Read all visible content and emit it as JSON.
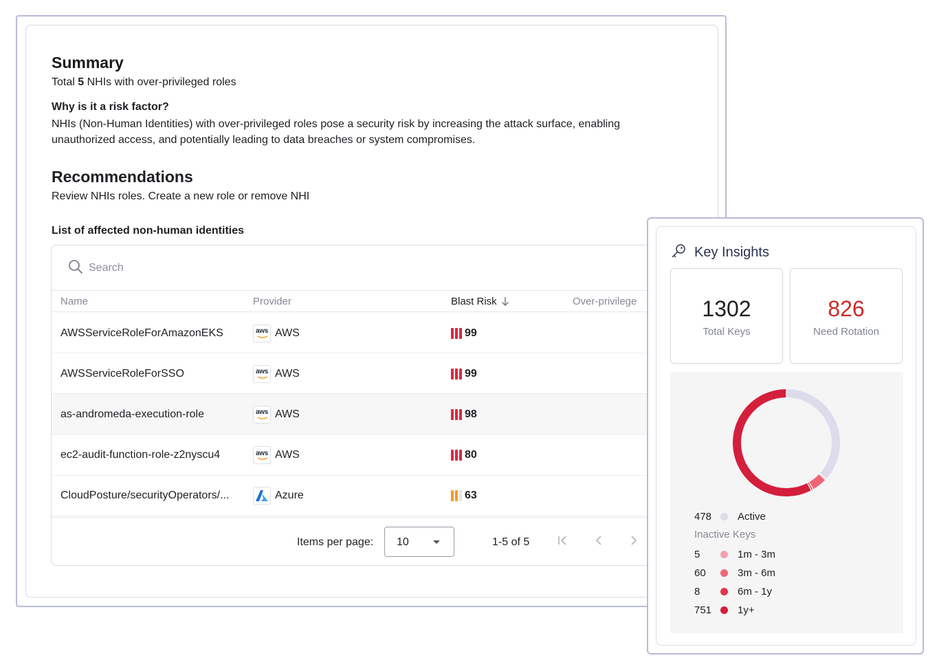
{
  "summary": {
    "heading": "Summary",
    "total_prefix": "Total",
    "total_count": "5",
    "total_suffix": "NHIs with over-privileged roles",
    "risk_question": "Why is it a risk factor?",
    "risk_text": "NHIs (Non-Human Identities) with over-privileged roles pose a security risk by increasing the attack surface, enabling unauthorized access, and potentially leading to data breaches or system compromises."
  },
  "recommendations": {
    "heading": "Recommendations",
    "text": "Review NHIs roles. Create a new role or remove NHI"
  },
  "list": {
    "title": "List of affected non-human identities",
    "search_placeholder": "Search",
    "columns": {
      "name": "Name",
      "provider": "Provider",
      "blast_risk": "Blast Risk",
      "over_privileged": "Over-privilege"
    },
    "rows": [
      {
        "name": "AWSServiceRoleForAmazonEKS",
        "provider": "AWS",
        "logo": "aws-logo",
        "risk": "99",
        "risk_bars_filled": 3,
        "risk_color": "#d62a44"
      },
      {
        "name": "AWSServiceRoleForSSO",
        "provider": "AWS",
        "logo": "aws-logo",
        "risk": "99",
        "risk_bars_filled": 3,
        "risk_color": "#d62a44"
      },
      {
        "name": "as-andromeda-execution-role",
        "provider": "AWS",
        "logo": "aws-logo",
        "risk": "98",
        "risk_bars_filled": 3,
        "risk_color": "#d62a44"
      },
      {
        "name": "ec2-audit-function-role-z2nyscu4",
        "provider": "AWS",
        "logo": "aws-logo",
        "risk": "80",
        "risk_bars_filled": 3,
        "risk_color": "#d62a44"
      },
      {
        "name": "CloudPosture/securityOperators/...",
        "provider": "Azure",
        "logo": "azure-logo",
        "risk": "63",
        "risk_bars_filled": 2,
        "risk_color": "#f29a27"
      }
    ],
    "pagination": {
      "items_per_page_label": "Items per page:",
      "items_per_page_value": "10",
      "range": "1-5 of 5"
    }
  },
  "key_insights": {
    "title": "Key Insights",
    "total_keys_value": "1302",
    "total_keys_label": "Total Keys",
    "need_rotation_value": "826",
    "need_rotation_label": "Need Rotation",
    "chart_data": {
      "type": "pie",
      "style": "donut",
      "categories": [
        "Active",
        "1m - 3m",
        "3m - 6m",
        "6m - 1y",
        "1y+"
      ],
      "values": [
        478,
        5,
        60,
        8,
        751
      ],
      "colors": [
        "#dcdcea",
        "#f5a0ae",
        "#ef6577",
        "#e3344d",
        "#d41f3c"
      ]
    },
    "legend": {
      "active": {
        "value": "478",
        "label": "Active",
        "color": "#dcdcea"
      },
      "inactive_label": "Inactive Keys",
      "inactive": [
        {
          "value": "5",
          "label": "1m - 3m",
          "color": "#f5a0ae"
        },
        {
          "value": "60",
          "label": "3m - 6m",
          "color": "#ef6577"
        },
        {
          "value": "8",
          "label": "6m - 1y",
          "color": "#e3344d"
        },
        {
          "value": "751",
          "label": "1y+",
          "color": "#d41f3c"
        }
      ]
    }
  }
}
